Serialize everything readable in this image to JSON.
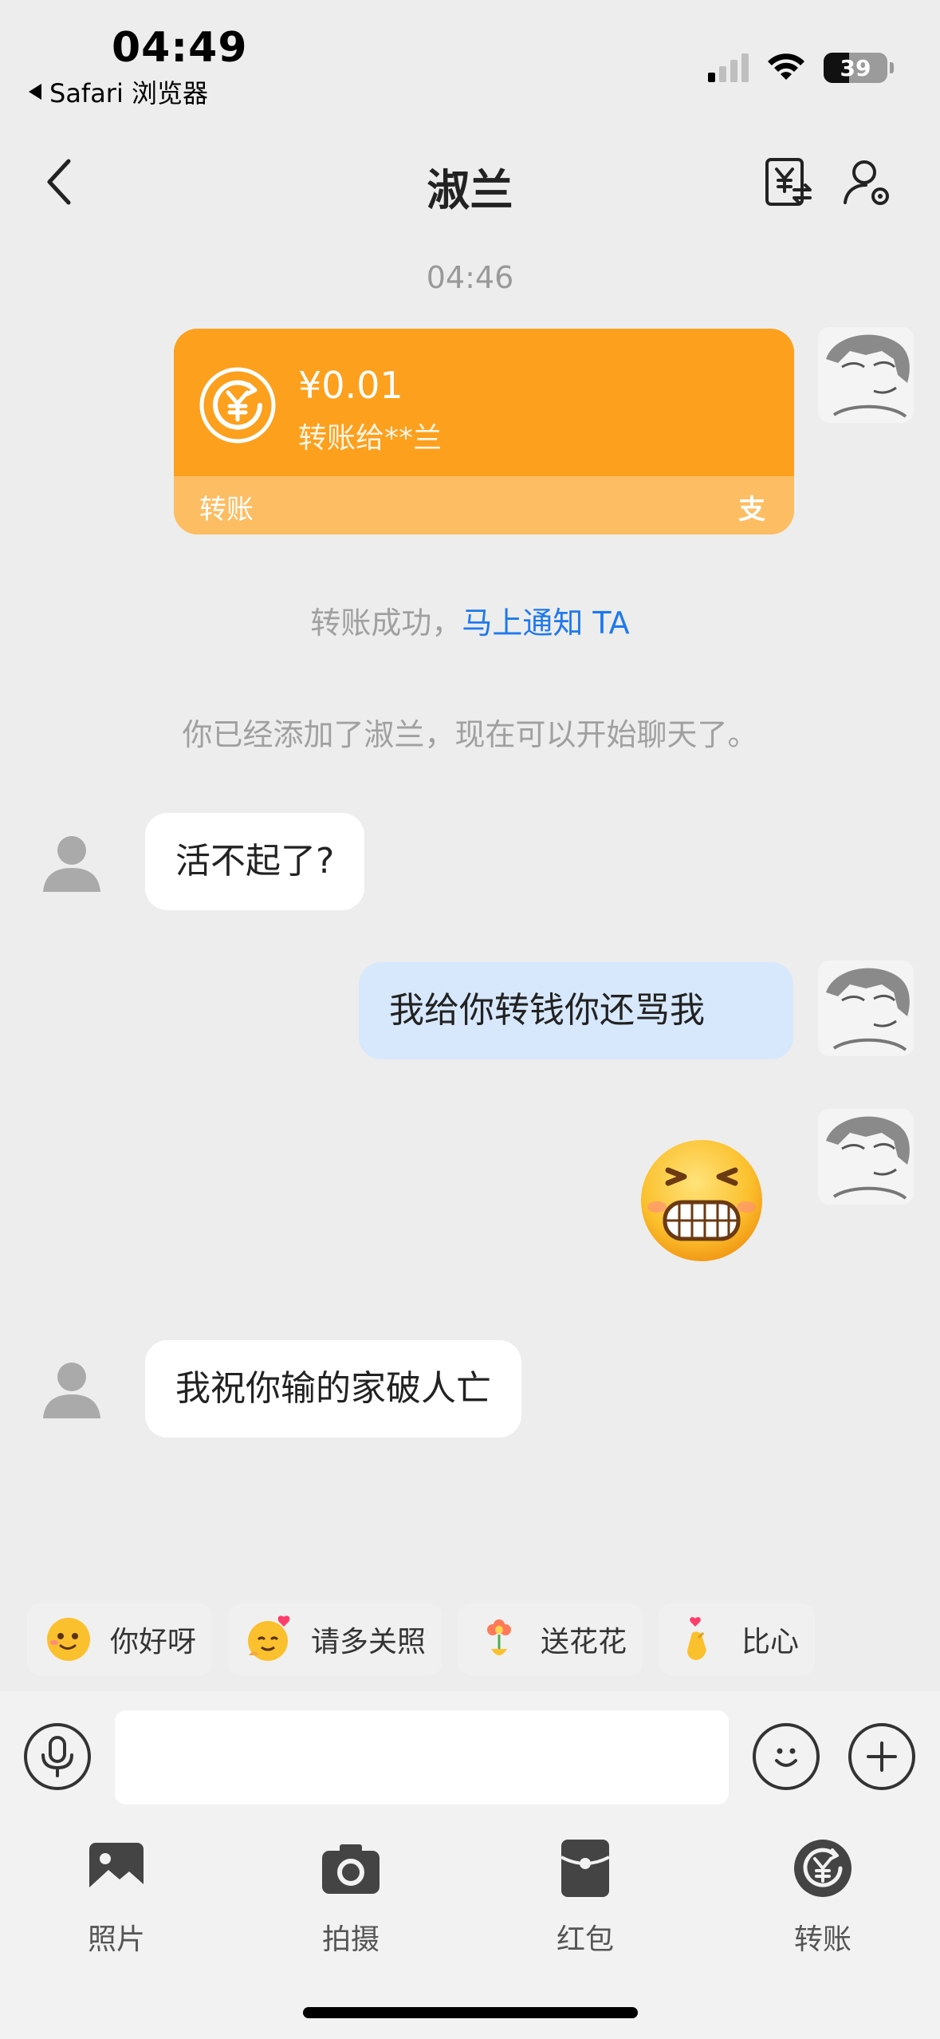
{
  "status_bar": {
    "time": "04:49",
    "back_app": "Safari 浏览器",
    "battery": "39"
  },
  "nav": {
    "title": "淑兰",
    "icons": [
      "back-chevron-icon",
      "transfer-record-icon",
      "user-settings-icon"
    ]
  },
  "chat": {
    "time_label": "04:46",
    "transfer": {
      "amount": "¥0.01",
      "recipient": "转账给**兰",
      "label": "转账",
      "brand_mark": "支"
    },
    "transfer_notice": {
      "text": "转账成功，",
      "link": "马上通知 TA"
    },
    "added_notice": "你已经添加了淑兰，现在可以开始聊天了。",
    "messages": [
      {
        "side": "in",
        "text": "活不起了?"
      },
      {
        "side": "out",
        "text": "我给你转钱你还骂我"
      },
      {
        "side": "out",
        "emoji": "grimacing-grin-emoji"
      },
      {
        "side": "in",
        "text": "我祝你输的家破人亡"
      }
    ]
  },
  "quick_replies": [
    {
      "emoji": "waving-face-emoji",
      "label": "你好呀"
    },
    {
      "emoji": "hugging-heart-emoji",
      "label": "请多关照"
    },
    {
      "emoji": "flower-emoji",
      "label": "送花花"
    },
    {
      "emoji": "finger-heart-emoji",
      "label": "比心"
    }
  ],
  "input": {
    "placeholder": "",
    "value": ""
  },
  "toolbar": {
    "items": [
      {
        "label": "照片",
        "icon": "photo-icon"
      },
      {
        "label": "拍摄",
        "icon": "camera-icon"
      },
      {
        "label": "红包",
        "icon": "red-packet-icon"
      },
      {
        "label": "转账",
        "icon": "transfer-icon"
      }
    ]
  },
  "colors": {
    "background": "#ededed",
    "transfer_orange": "#fca01e",
    "outgoing_bubble": "#d7e8fd",
    "link_blue": "#1f79ed"
  }
}
